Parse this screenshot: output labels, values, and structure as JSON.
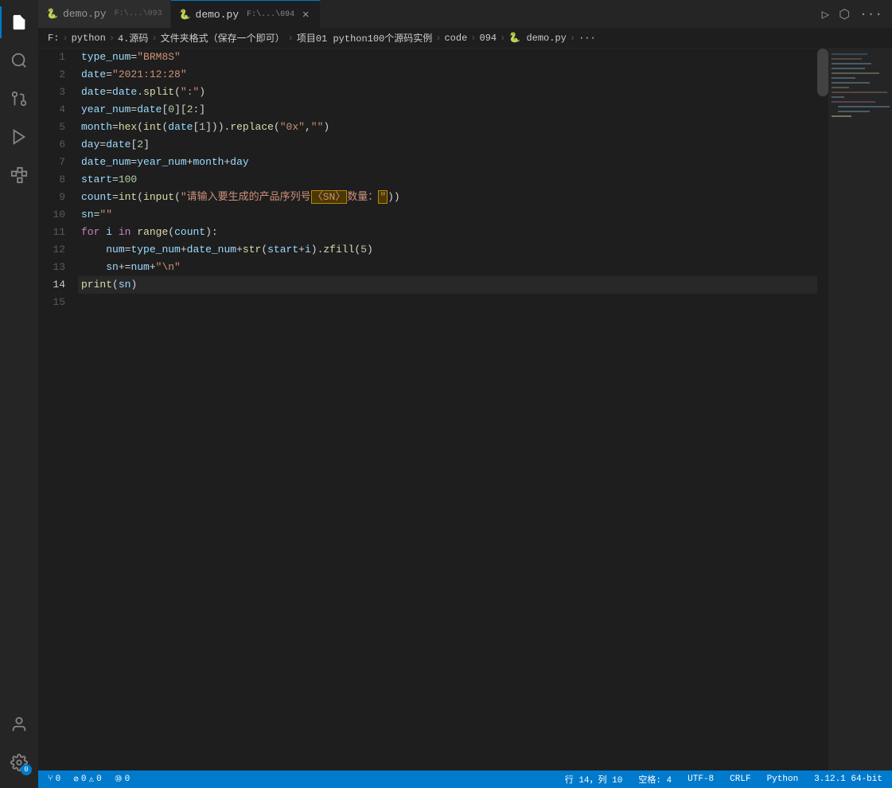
{
  "tabs": [
    {
      "label": "demo.py",
      "path": "F:\\...\\093",
      "active": false,
      "icon": "🐍"
    },
    {
      "label": "demo.py",
      "path": "F:\\...\\094",
      "active": true,
      "icon": "🐍"
    }
  ],
  "tabActions": [
    "▷",
    "⬡",
    "···"
  ],
  "breadcrumb": [
    "F:",
    "python",
    "4.源码",
    "文件夹格式（保存一个即可）",
    "项目01 python100个源码实例",
    "code",
    "094",
    "demo.py",
    "···"
  ],
  "lines": [
    {
      "num": 1,
      "tokens": [
        {
          "t": "var",
          "v": "type_num"
        },
        {
          "t": "op",
          "v": "="
        },
        {
          "t": "str",
          "v": "\"BRM8S\""
        }
      ]
    },
    {
      "num": 2,
      "tokens": [
        {
          "t": "var",
          "v": "date"
        },
        {
          "t": "op",
          "v": "="
        },
        {
          "t": "str",
          "v": "\"2021:12:28\""
        }
      ]
    },
    {
      "num": 3,
      "tokens": [
        {
          "t": "var",
          "v": "date"
        },
        {
          "t": "op",
          "v": "="
        },
        {
          "t": "var",
          "v": "date"
        },
        {
          "t": "op",
          "v": "."
        },
        {
          "t": "fn",
          "v": "split"
        },
        {
          "t": "plain",
          "v": "("
        },
        {
          "t": "str",
          "v": "\":\""
        },
        {
          "t": "plain",
          "v": ")"
        }
      ]
    },
    {
      "num": 4,
      "tokens": [
        {
          "t": "var",
          "v": "year_num"
        },
        {
          "t": "op",
          "v": "="
        },
        {
          "t": "var",
          "v": "date"
        },
        {
          "t": "plain",
          "v": "["
        },
        {
          "t": "num",
          "v": "0"
        },
        {
          "t": "plain",
          "v": "]["
        },
        {
          "t": "num",
          "v": "2"
        },
        {
          "t": "plain",
          "v": ":"
        },
        {
          "t": "plain",
          "v": "]"
        }
      ]
    },
    {
      "num": 5,
      "tokens": [
        {
          "t": "var",
          "v": "month"
        },
        {
          "t": "op",
          "v": "="
        },
        {
          "t": "fn",
          "v": "hex"
        },
        {
          "t": "plain",
          "v": "("
        },
        {
          "t": "fn",
          "v": "int"
        },
        {
          "t": "plain",
          "v": "("
        },
        {
          "t": "var",
          "v": "date"
        },
        {
          "t": "plain",
          "v": "["
        },
        {
          "t": "num",
          "v": "1"
        },
        {
          "t": "plain",
          "v": "]))"
        },
        {
          "t": "op",
          "v": "."
        },
        {
          "t": "fn",
          "v": "replace"
        },
        {
          "t": "plain",
          "v": "("
        },
        {
          "t": "str",
          "v": "\"0x\""
        },
        {
          "t": "plain",
          "v": ","
        },
        {
          "t": "str",
          "v": "\"\""
        },
        {
          "t": "plain",
          "v": ")"
        }
      ]
    },
    {
      "num": 6,
      "tokens": [
        {
          "t": "var",
          "v": "day"
        },
        {
          "t": "op",
          "v": "="
        },
        {
          "t": "var",
          "v": "date"
        },
        {
          "t": "plain",
          "v": "["
        },
        {
          "t": "num",
          "v": "2"
        },
        {
          "t": "plain",
          "v": "]"
        }
      ]
    },
    {
      "num": 7,
      "tokens": [
        {
          "t": "var",
          "v": "date_num"
        },
        {
          "t": "op",
          "v": "="
        },
        {
          "t": "var",
          "v": "year_num"
        },
        {
          "t": "op",
          "v": "+"
        },
        {
          "t": "var",
          "v": "month"
        },
        {
          "t": "op",
          "v": "+"
        },
        {
          "t": "var",
          "v": "day"
        }
      ]
    },
    {
      "num": 8,
      "tokens": [
        {
          "t": "var",
          "v": "start"
        },
        {
          "t": "op",
          "v": "="
        },
        {
          "t": "num",
          "v": "100"
        }
      ]
    },
    {
      "num": 9,
      "tokens": [
        {
          "t": "var",
          "v": "count"
        },
        {
          "t": "op",
          "v": "="
        },
        {
          "t": "fn",
          "v": "int"
        },
        {
          "t": "plain",
          "v": "("
        },
        {
          "t": "fn",
          "v": "input"
        },
        {
          "t": "plain",
          "v": "("
        },
        {
          "t": "str",
          "v": "\"请输入要生成的产品序列号"
        },
        {
          "t": "highlight",
          "v": "〈SN〉"
        },
        {
          "t": "str",
          "v": "数量："
        },
        {
          "t": "highlight2",
          "v": "\""
        },
        {
          "t": "plain",
          "v": "))"
        }
      ]
    },
    {
      "num": 10,
      "tokens": [
        {
          "t": "var",
          "v": "sn"
        },
        {
          "t": "op",
          "v": "="
        },
        {
          "t": "str",
          "v": "\"\""
        }
      ]
    },
    {
      "num": 11,
      "tokens": [
        {
          "t": "kw",
          "v": "for"
        },
        {
          "t": "plain",
          "v": " "
        },
        {
          "t": "var",
          "v": "i"
        },
        {
          "t": "plain",
          "v": " "
        },
        {
          "t": "kw",
          "v": "in"
        },
        {
          "t": "plain",
          "v": " "
        },
        {
          "t": "fn",
          "v": "range"
        },
        {
          "t": "plain",
          "v": "("
        },
        {
          "t": "var",
          "v": "count"
        },
        {
          "t": "plain",
          "v": "):"
        }
      ]
    },
    {
      "num": 12,
      "tokens": [
        {
          "t": "indent",
          "v": "    "
        },
        {
          "t": "var",
          "v": "num"
        },
        {
          "t": "op",
          "v": "="
        },
        {
          "t": "var",
          "v": "type_num"
        },
        {
          "t": "op",
          "v": "+"
        },
        {
          "t": "var",
          "v": "date_num"
        },
        {
          "t": "op",
          "v": "+"
        },
        {
          "t": "fn",
          "v": "str"
        },
        {
          "t": "plain",
          "v": "("
        },
        {
          "t": "var",
          "v": "start"
        },
        {
          "t": "op",
          "v": "+"
        },
        {
          "t": "var",
          "v": "i"
        },
        {
          "t": "plain",
          "v": ")."
        },
        {
          "t": "fn",
          "v": "zfill"
        },
        {
          "t": "plain",
          "v": "("
        },
        {
          "t": "num",
          "v": "5"
        },
        {
          "t": "plain",
          "v": ")"
        }
      ]
    },
    {
      "num": 13,
      "tokens": [
        {
          "t": "indent",
          "v": "    "
        },
        {
          "t": "var",
          "v": "sn"
        },
        {
          "t": "op",
          "v": "+="
        },
        {
          "t": "var",
          "v": "num"
        },
        {
          "t": "op",
          "v": "+"
        },
        {
          "t": "str",
          "v": "\"\\n\""
        }
      ]
    },
    {
      "num": 14,
      "tokens": [
        {
          "t": "fn",
          "v": "print"
        },
        {
          "t": "plain",
          "v": "("
        },
        {
          "t": "var",
          "v": "sn"
        },
        {
          "t": "plain",
          "v": ")"
        }
      ]
    },
    {
      "num": 15,
      "tokens": []
    }
  ],
  "statusBar": {
    "left": {
      "branch_icon": "⑂",
      "errors": "0",
      "warnings": "0",
      "info": "⑩0"
    },
    "right": {
      "cursor": "行 14，列 10",
      "spaces": "空格: 4",
      "encoding": "UTF-8",
      "lineEnding": "CRLF",
      "language": "Python",
      "version": "3.12.1 64-bit"
    }
  },
  "activityIcons": [
    "files",
    "search",
    "git",
    "extensions",
    "debug",
    "remote"
  ],
  "windowTitle": "demo.py"
}
